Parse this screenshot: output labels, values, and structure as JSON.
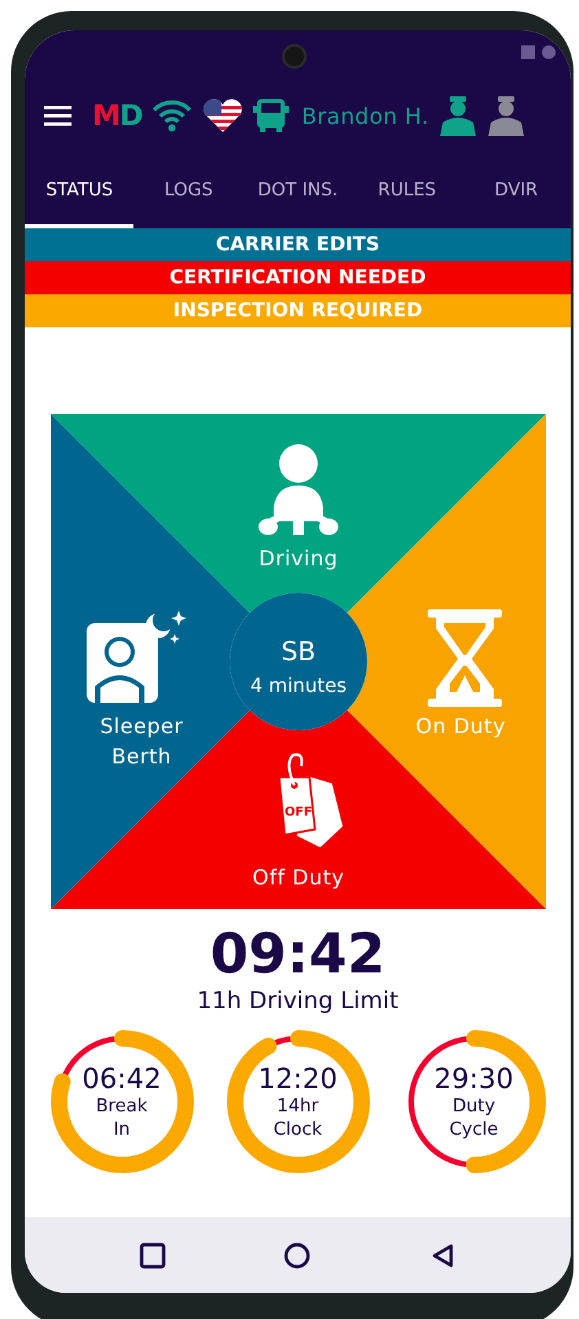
{
  "header": {
    "logo": "MD",
    "driver_name": "Brandon H.",
    "drivers": [
      {
        "selected": true
      },
      {
        "selected": false
      }
    ]
  },
  "tabs": [
    {
      "label": "STATUS",
      "selected": true
    },
    {
      "label": "LOGS",
      "selected": false
    },
    {
      "label": "DOT INS.",
      "selected": false
    },
    {
      "label": "RULES",
      "selected": false
    },
    {
      "label": "DVIR",
      "selected": false
    }
  ],
  "banners": [
    {
      "text": "CARRIER EDITS",
      "color": "#007093"
    },
    {
      "text": "CERTIFICATION NEEDED",
      "color": "#f40000"
    },
    {
      "text": "INSPECTION REQUIRED",
      "color": "#fba800"
    }
  ],
  "status_wheel": {
    "quadrants": [
      {
        "kind": "driving",
        "label": "Driving",
        "color": "#00a480"
      },
      {
        "kind": "on_duty",
        "label": "On Duty",
        "color": "#f9a300"
      },
      {
        "kind": "off_duty",
        "label": "Off Duty",
        "color": "#f40000"
      },
      {
        "kind": "sleeper",
        "label": "Sleeper\nBerth",
        "color": "#006690"
      }
    ],
    "current": {
      "status": "SB",
      "duration": "4 minutes"
    },
    "tag_text": "OFF"
  },
  "driving_limit": {
    "time": "09:42",
    "label": "11h Driving Limit"
  },
  "timers": [
    {
      "time": "06:42",
      "label": "Break\nIn",
      "level": 0.8
    },
    {
      "time": "12:20",
      "label": "14hr\nClock",
      "level": 0.92
    },
    {
      "time": "29:30",
      "label": "Duty\nCycle",
      "level": 0.5
    }
  ]
}
